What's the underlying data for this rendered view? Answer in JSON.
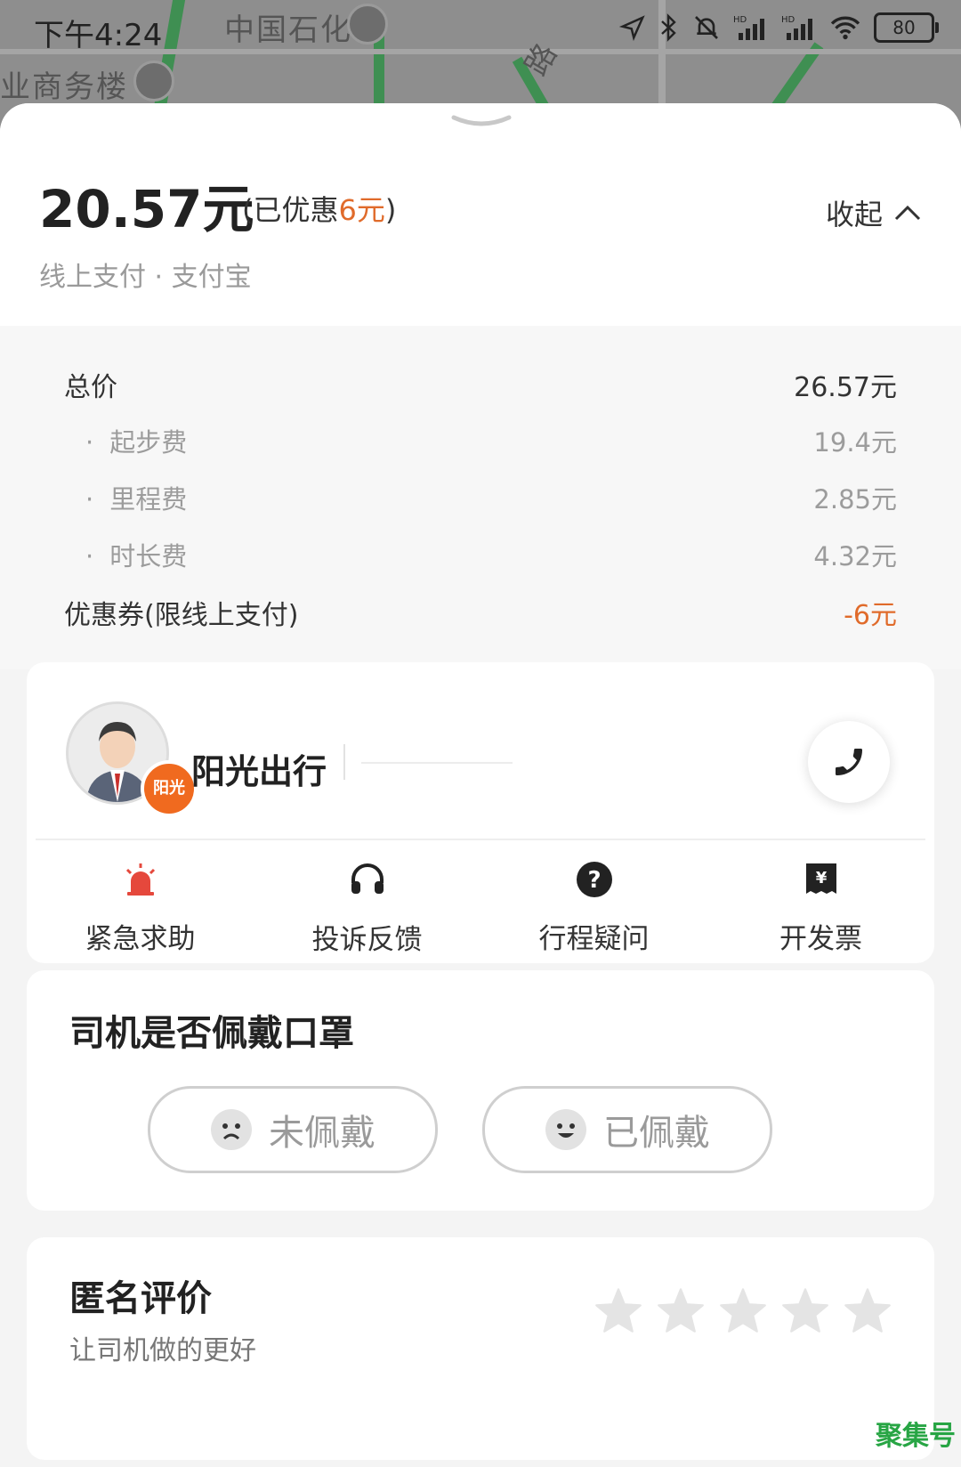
{
  "status_bar": {
    "time": "下午4:24",
    "battery": "80"
  },
  "map": {
    "labels": [
      "中国石化",
      "业商务楼",
      "路"
    ]
  },
  "summary": {
    "price": "20.57元",
    "discount_prefix": "(已优惠",
    "discount_amount": "6元",
    "discount_suffix": ")",
    "payment_method": "线上支付 · 支付宝",
    "collapse_label": "收起"
  },
  "breakdown": {
    "total": {
      "label": "总价",
      "value": "26.57元"
    },
    "items": [
      {
        "label": "起步费",
        "value": "19.4元"
      },
      {
        "label": "里程费",
        "value": "2.85元"
      },
      {
        "label": "时长费",
        "value": "4.32元"
      }
    ],
    "coupon": {
      "label": "优惠券(限线上支付)",
      "value": "-6元"
    }
  },
  "driver": {
    "name": "阳光出行",
    "badge": "阳光"
  },
  "actions": [
    {
      "label": "紧急求助",
      "icon": "alarm-icon"
    },
    {
      "label": "投诉反馈",
      "icon": "headset-icon"
    },
    {
      "label": "行程疑问",
      "icon": "question-icon"
    },
    {
      "label": "开发票",
      "icon": "invoice-icon"
    }
  ],
  "mask": {
    "title": "司机是否佩戴口罩",
    "not_worn": "未佩戴",
    "worn": "已佩戴"
  },
  "rating": {
    "title": "匿名评价",
    "subtitle": "让司机做的更好",
    "stars": 5
  },
  "watermark": "聚集号",
  "colors": {
    "accent_orange": "#e06b2b",
    "alarm_red": "#e5483c",
    "watermark_green": "#27a544"
  }
}
